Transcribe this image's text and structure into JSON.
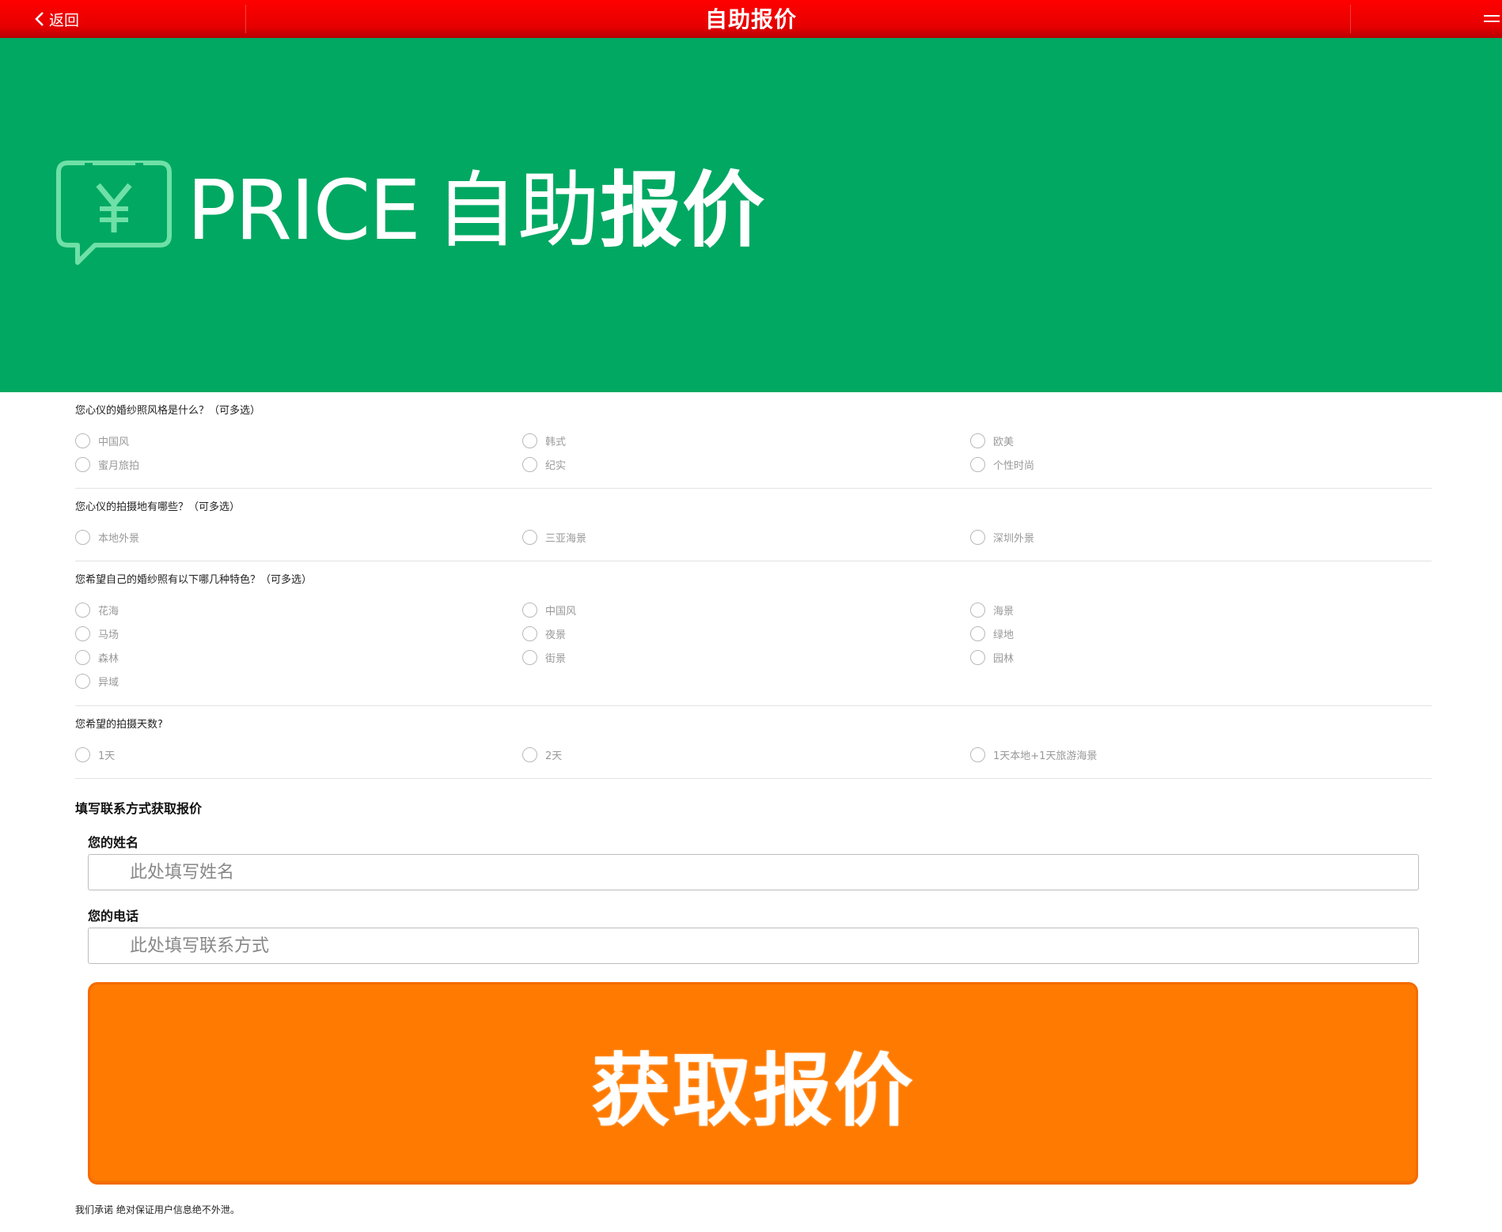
{
  "header": {
    "back_label": "返回",
    "title": "自助报价"
  },
  "banner": {
    "text_en": "PRICE",
    "text_cn_light": "自助",
    "text_cn_bold": "报价",
    "icon": "yen-chat-bubble-icon",
    "background": "#00a862"
  },
  "questions": [
    {
      "title": "您心仪的婚纱照风格是什么？（可多选）",
      "options": [
        "中国风",
        "韩式",
        "欧美",
        "蜜月旅拍",
        "纪实",
        "个性时尚"
      ]
    },
    {
      "title": "您心仪的拍摄地有哪些？（可多选）",
      "options": [
        "本地外景",
        "三亚海景",
        "深圳外景"
      ]
    },
    {
      "title": "您希望自己的婚纱照有以下哪几种特色？（可多选）",
      "options": [
        "花海",
        "中国风",
        "海景",
        "马场",
        "夜景",
        "绿地",
        "森林",
        "街景",
        "园林",
        "异域"
      ]
    },
    {
      "title": "您希望的拍摄天数?",
      "options": [
        "1天",
        "2天",
        "1天本地+1天旅游海景"
      ]
    }
  ],
  "contact": {
    "title": "填写联系方式获取报价",
    "name_label": "您的姓名",
    "name_placeholder": "此处填写姓名",
    "phone_label": "您的电话",
    "phone_placeholder": "此处填写联系方式",
    "submit_label": "获取报价"
  },
  "footer_note": "我们承诺 绝对保证用户信息绝不外泄。",
  "colors": {
    "header": "#e60000",
    "banner": "#00a862",
    "button": "#ff7a00"
  }
}
